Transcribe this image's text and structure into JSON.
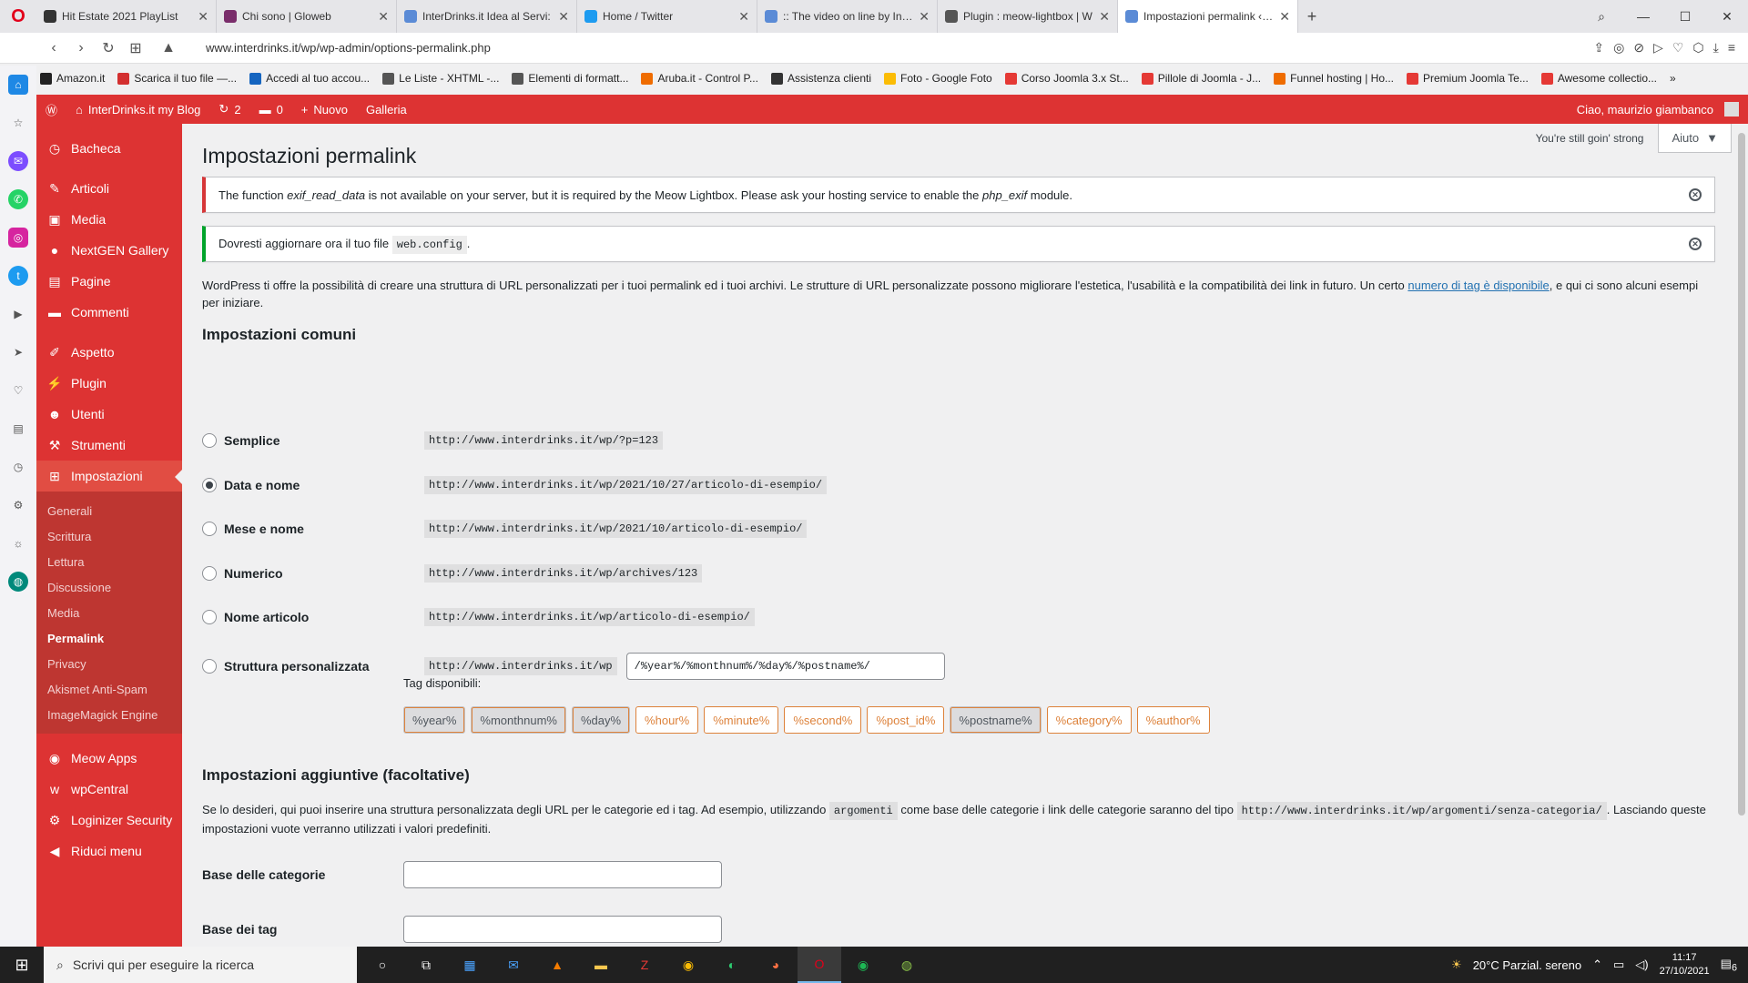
{
  "browser": {
    "tabs": [
      {
        "title": "Hit Estate 2021 PlayList",
        "color": "#333333"
      },
      {
        "title": "Chi sono | Gloweb",
        "color": "#7a2d6b"
      },
      {
        "title": "InterDrinks.it Idea al Servi:",
        "color": "#5b8bd6"
      },
      {
        "title": "Home / Twitter",
        "color": "#1d9bf0"
      },
      {
        "title": ":: The video on line by Inter",
        "color": "#5b8bd6"
      },
      {
        "title": "Plugin : meow-lightbox | W",
        "color": "#555555"
      },
      {
        "title": "Impostazioni permalink ‹ In",
        "color": "#5b8bd6"
      }
    ],
    "url": "www.interdrinks.it/wp/wp-admin/options-permalink.php",
    "bookmarks": [
      {
        "label": "Amazon.it",
        "color": "#222222"
      },
      {
        "label": "Scarica il tuo file —...",
        "color": "#d32f2f"
      },
      {
        "label": "Accedi al tuo accou...",
        "color": "#1565c0"
      },
      {
        "label": "Le Liste - XHTML -...",
        "color": "#555555"
      },
      {
        "label": "Elementi di formatt...",
        "color": "#555555"
      },
      {
        "label": "Aruba.it - Control P...",
        "color": "#ef6c00"
      },
      {
        "label": "Assistenza clienti",
        "color": "#333333"
      },
      {
        "label": "Foto - Google Foto",
        "color": "#fbbc05"
      },
      {
        "label": "Corso Joomla 3.x St...",
        "color": "#e53935"
      },
      {
        "label": "Pillole di Joomla - J...",
        "color": "#e53935"
      },
      {
        "label": "Funnel hosting | Ho...",
        "color": "#ef6c00"
      },
      {
        "label": "Premium Joomla Te...",
        "color": "#e53935"
      },
      {
        "label": "Awesome collectio...",
        "color": "#e53935"
      }
    ]
  },
  "adminbar": {
    "site": "InterDrinks.it my Blog",
    "updates": "2",
    "comments": "0",
    "new": "Nuovo",
    "gallery": "Galleria",
    "greeting": "Ciao, maurizio giambanco"
  },
  "menu": {
    "items_top": [
      {
        "label": "Bacheca",
        "icon": "dashboard-icon",
        "glyph": "◷"
      }
    ],
    "items_mid": [
      {
        "label": "Articoli",
        "icon": "pin-icon",
        "glyph": "✎"
      },
      {
        "label": "Media",
        "icon": "media-icon",
        "glyph": "▣"
      },
      {
        "label": "NextGEN Gallery",
        "icon": "nextgen-icon",
        "glyph": "●"
      },
      {
        "label": "Pagine",
        "icon": "page-icon",
        "glyph": "▤"
      },
      {
        "label": "Commenti",
        "icon": "comment-icon",
        "glyph": "▬"
      }
    ],
    "items_low": [
      {
        "label": "Aspetto",
        "icon": "brush-icon",
        "glyph": "✐"
      },
      {
        "label": "Plugin",
        "icon": "plugin-icon",
        "glyph": "⚡"
      },
      {
        "label": "Utenti",
        "icon": "user-icon",
        "glyph": "☻"
      },
      {
        "label": "Strumenti",
        "icon": "wrench-icon",
        "glyph": "⚒"
      }
    ],
    "current": {
      "label": "Impostazioni",
      "icon": "settings-icon",
      "glyph": "⊞"
    },
    "submenu": [
      "Generali",
      "Scrittura",
      "Lettura",
      "Discussione",
      "Media",
      "Permalink",
      "Privacy",
      "Akismet Anti-Spam",
      "ImageMagick Engine"
    ],
    "submenu_current": "Permalink",
    "items_bottom": [
      {
        "label": "Meow Apps",
        "icon": "meow-icon",
        "glyph": "◉"
      },
      {
        "label": "wpCentral",
        "icon": "wpcentral-icon",
        "glyph": "w"
      },
      {
        "label": "Loginizer Security",
        "icon": "gear-icon",
        "glyph": "⚙"
      },
      {
        "label": "Riduci menu",
        "icon": "collapse-icon",
        "glyph": "◀"
      }
    ]
  },
  "page": {
    "title": "Impostazioni permalink",
    "still_going": "You're still goin' strong",
    "help": "Aiuto",
    "error_notice": {
      "pre": "The function ",
      "fn": "exif_read_data",
      "mid": " is not available on your server, but it is required by the Meow Lightbox. Please ask your hosting service to enable the ",
      "mod": "php_exif",
      "post": " module."
    },
    "success_notice": {
      "pre": "Dovresti aggiornare ora il tuo file ",
      "code": "web.config",
      "post": "."
    },
    "intro": {
      "text": "WordPress ti offre la possibilità di creare una struttura di URL personalizzati per i tuoi permalink ed i tuoi archivi. Le strutture di URL personalizzate possono migliorare l'estetica, l'usabilità e la compatibilità dei link in futuro. Un certo ",
      "link": "numero di tag è disponibile",
      "after": ", e qui ci sono alcuni esempi per iniziare."
    },
    "common_heading": "Impostazioni comuni",
    "options": [
      {
        "label": "Semplice",
        "example": "http://www.interdrinks.it/wp/?p=123",
        "checked": false
      },
      {
        "label": "Data e nome",
        "example": "http://www.interdrinks.it/wp/2021/10/27/articolo-di-esempio/",
        "checked": true
      },
      {
        "label": "Mese e nome",
        "example": "http://www.interdrinks.it/wp/2021/10/articolo-di-esempio/",
        "checked": false
      },
      {
        "label": "Numerico",
        "example": "http://www.interdrinks.it/wp/archives/123",
        "checked": false
      },
      {
        "label": "Nome articolo",
        "example": "http://www.interdrinks.it/wp/articolo-di-esempio/",
        "checked": false
      }
    ],
    "custom": {
      "label": "Struttura personalizzata",
      "base": "http://www.interdrinks.it/wp",
      "value": "/%year%/%monthnum%/%day%/%postname%/"
    },
    "available_tags_label": "Tag disponibili:",
    "tags": [
      {
        "label": "%year%",
        "selected": true
      },
      {
        "label": "%monthnum%",
        "selected": true
      },
      {
        "label": "%day%",
        "selected": true
      },
      {
        "label": "%hour%",
        "selected": false
      },
      {
        "label": "%minute%",
        "selected": false
      },
      {
        "label": "%second%",
        "selected": false
      },
      {
        "label": "%post_id%",
        "selected": false
      },
      {
        "label": "%postname%",
        "selected": true
      },
      {
        "label": "%category%",
        "selected": false
      },
      {
        "label": "%author%",
        "selected": false
      }
    ],
    "optional_heading": "Impostazioni aggiuntive (facoltative)",
    "optional_text": {
      "a": "Se lo desideri, qui puoi inserire una struttura personalizzata degli URL per le categorie ed i tag. Ad esempio, utilizzando ",
      "code1": "argomenti",
      "b": " come base delle categorie i link delle categorie saranno del tipo ",
      "code2": "http://www.interdrinks.it/wp/argomenti/senza-categoria/",
      "c": ". Lasciando queste impostazioni vuote verranno utilizzati i valori predefiniti."
    },
    "category_base_label": "Base delle categorie",
    "tag_base_label": "Base dei tag"
  },
  "taskbar": {
    "search_placeholder": "Scrivi qui per eseguire la ricerca",
    "weather": "20°C  Parzial. sereno",
    "time": "11:17",
    "date": "27/10/2021",
    "notifications": "6"
  },
  "colors": {
    "admin_red": "#dd3333",
    "menu_dark": "#be3631",
    "tag_orange": "#dd823b"
  }
}
